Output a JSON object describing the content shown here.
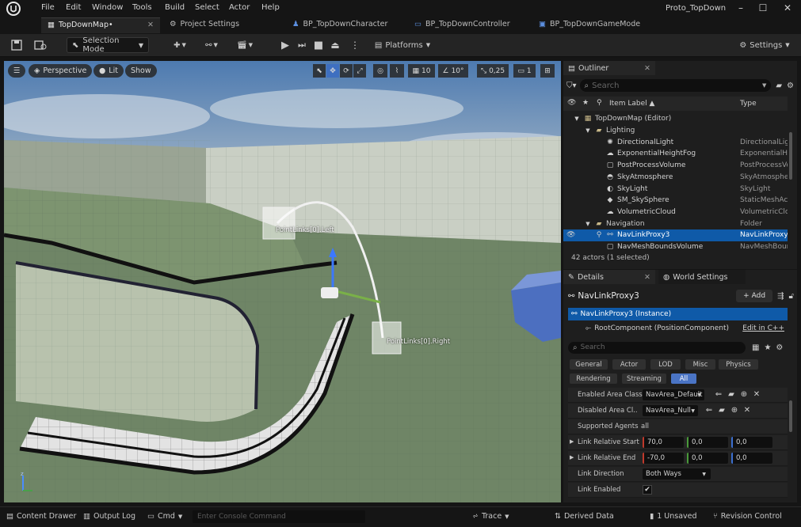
{
  "app": {
    "project_name": "Proto_TopDown"
  },
  "menu": [
    "File",
    "Edit",
    "Window",
    "Tools",
    "Build",
    "Select",
    "Actor",
    "Help"
  ],
  "tabs": [
    {
      "label": "TopDownMap•",
      "icon": "level-icon",
      "active": true
    },
    {
      "label": "Project Settings",
      "icon": "gear-icon",
      "active": false
    },
    {
      "label": "BP_TopDownCharacter",
      "icon": "character-blueprint-icon",
      "active": false
    },
    {
      "label": "BP_TopDownController",
      "icon": "controller-blueprint-icon",
      "active": false
    },
    {
      "label": "BP_TopDownGameMode",
      "icon": "gamemode-blueprint-icon",
      "active": false
    }
  ],
  "toolbar": {
    "selection_mode": "Selection Mode",
    "platforms": "Platforms",
    "settings": "Settings"
  },
  "viewport": {
    "perspective": "Perspective",
    "lit": "Lit",
    "show": "Show",
    "grid_snap": "10",
    "rotation_snap": "10°",
    "scale_snap": "0,25",
    "camera_speed": "1",
    "label_left": "PointLinks[0].Left",
    "label_right": "PointLinks[0].Right"
  },
  "outliner": {
    "tab_label": "Outliner",
    "search_placeholder": "Search",
    "col_label": "Item Label ▲",
    "col_type": "Type",
    "rows": [
      {
        "label": "TopDownMap (Editor)",
        "type": "",
        "indent": 1,
        "icon": "level-icon",
        "folder": true
      },
      {
        "label": "Lighting",
        "type": "",
        "indent": 2,
        "icon": "folder-icon",
        "folder": true
      },
      {
        "label": "DirectionalLight",
        "type": "DirectionalLight",
        "indent": 3,
        "icon": "sun-icon"
      },
      {
        "label": "ExponentialHeightFog",
        "type": "ExponentialHeightFog",
        "indent": 3,
        "icon": "fog-icon"
      },
      {
        "label": "PostProcessVolume",
        "type": "PostProcessVolume",
        "indent": 3,
        "icon": "volume-icon"
      },
      {
        "label": "SkyAtmosphere",
        "type": "SkyAtmosphere",
        "indent": 3,
        "icon": "sky-icon"
      },
      {
        "label": "SkyLight",
        "type": "SkyLight",
        "indent": 3,
        "icon": "skylight-icon"
      },
      {
        "label": "SM_SkySphere",
        "type": "StaticMeshActor",
        "indent": 3,
        "icon": "mesh-icon"
      },
      {
        "label": "VolumetricCloud",
        "type": "VolumetricCloud",
        "indent": 3,
        "icon": "cloud-icon"
      },
      {
        "label": "Navigation",
        "type": "Folder",
        "indent": 2,
        "icon": "folder-icon",
        "folder": true
      },
      {
        "label": "NavLinkProxy3",
        "type": "NavLinkProxy",
        "indent": 3,
        "icon": "navlink-icon",
        "selected": true
      },
      {
        "label": "NavMeshBoundsVolume",
        "type": "NavMeshBoundsVolume",
        "indent": 3,
        "icon": "volume-icon"
      }
    ],
    "footer": "42 actors (1 selected)"
  },
  "details": {
    "tab_label": "Details",
    "world_settings_tab": "World Settings",
    "actor_name": "NavLinkProxy3",
    "add_button": "Add",
    "instance_label": "NavLinkProxy3 (Instance)",
    "root_component": "RootComponent (PositionComponent)",
    "edit_link": "Edit in C++",
    "search_placeholder": "Search",
    "categories_row1": [
      "General",
      "Actor",
      "LOD",
      "Misc",
      "Physics"
    ],
    "categories_row2": [
      "Rendering",
      "Streaming",
      "All"
    ],
    "properties": {
      "enabled_area_class": {
        "name": "Enabled Area Class",
        "value": "NavArea_Default"
      },
      "disabled_area_class": {
        "name": "Disabled Area Cl..",
        "value": "NavArea_Null"
      },
      "supported_agents": {
        "name": "Supported Agents",
        "value": "all"
      },
      "link_relative_start": {
        "name": "Link Relative Start",
        "x": "70,0",
        "y": "0,0",
        "z": "0,0"
      },
      "link_relative_end": {
        "name": "Link Relative End",
        "x": "-70,0",
        "y": "0,0",
        "z": "0,0"
      },
      "link_direction": {
        "name": "Link Direction",
        "value": "Both Ways"
      },
      "link_enabled": {
        "name": "Link Enabled",
        "checked": true
      }
    }
  },
  "statusbar": {
    "content_drawer": "Content Drawer",
    "output_log": "Output Log",
    "cmd": "Cmd",
    "console_placeholder": "Enter Console Command",
    "trace": "Trace",
    "derived_data": "Derived Data",
    "unsaved": "1 Unsaved",
    "revision_control": "Revision Control"
  },
  "colors": {
    "accent_blue": "#0f5aa8",
    "active_category": "#4a74c4",
    "panel_bg": "#1e1e1e"
  }
}
